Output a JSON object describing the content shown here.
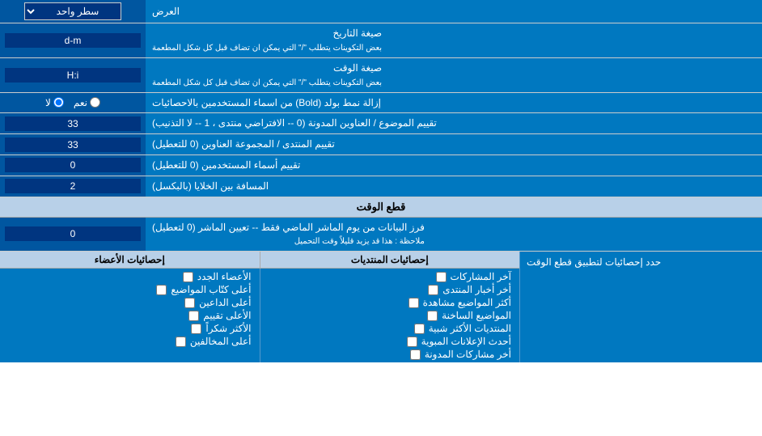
{
  "header": {
    "display_label": "العرض",
    "select_label": "سطر واحد"
  },
  "rows": [
    {
      "id": "date-format",
      "label": "صيغة التاريخ\nبعض التكوينات يتطلب \"/\" التي يمكن ان تضاف قبل كل شكل المطعمة",
      "input_value": "d-m",
      "type": "text"
    },
    {
      "id": "time-format",
      "label": "صيغة الوقت\nبعض التكوينات يتطلب \"/\" التي يمكن ان تضاف قبل كل شكل المطعمة",
      "input_value": "H:i",
      "type": "text"
    },
    {
      "id": "bold-remove",
      "label": "إزالة نمط بولد (Bold) من اسماء المستخدمين بالاحصائيات",
      "radio_yes": "نعم",
      "radio_no": "لا",
      "selected": "no",
      "type": "radio"
    },
    {
      "id": "topics-order",
      "label": "تقييم الموضوع / العناوين المدونة (0 -- الافتراضي منتدى ، 1 -- لا التذنيب)",
      "input_value": "33",
      "type": "text"
    },
    {
      "id": "forum-group",
      "label": "تقييم المنتدى / المجموعة العناوين (0 للتعطيل)",
      "input_value": "33",
      "type": "text"
    },
    {
      "id": "usernames",
      "label": "تقييم أسماء المستخدمين (0 للتعطيل)",
      "input_value": "0",
      "type": "text"
    },
    {
      "id": "cell-spacing",
      "label": "المسافة بين الخلايا (بالبكسل)",
      "input_value": "2",
      "type": "text"
    }
  ],
  "time_cut_section": {
    "header": "قطع الوقت",
    "row": {
      "label": "فرز البيانات من يوم الماشر الماضي فقط -- تعيين الماشر (0 لتعطيل)\nملاحظة : هذا قد يزيد قليلاً وقت التحميل",
      "input_value": "0",
      "type": "text"
    },
    "limit_label": "حدد إحصائيات لتطبيق قطع الوقت"
  },
  "bottom_section": {
    "col1_title": "إحصائيات الأعضاء",
    "col2_title": "إحصائيات المنتديات",
    "col1_items": [
      "الأعضاء الجدد",
      "أعلى كتّاب المواضيع",
      "أعلى الداعين",
      "الأعلى تقييم",
      "الأكثر شكراً",
      "أعلى المخالفين"
    ],
    "col2_items": [
      "آخر المشاركات",
      "أخر أخبار المنتدى",
      "أكثر المواضيع مشاهدة",
      "المواضيع الساخنة",
      "المنتديات الأكثر شبية",
      "أحدث الإعلانات المبوية",
      "أخر مشاركات المدونة"
    ]
  }
}
